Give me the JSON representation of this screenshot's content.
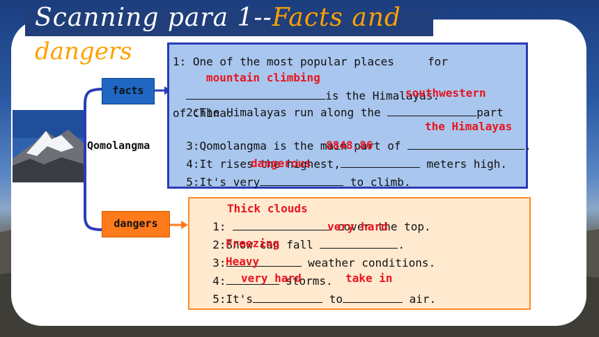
{
  "title": {
    "part1": "Scanning para 1--",
    "part2": "Facts and",
    "part3": "dangers"
  },
  "center_label": "Qomolangma",
  "tags": {
    "facts": "facts",
    "dangers": "dangers"
  },
  "facts": {
    "l1a": "1: One of the most popular places     for",
    "l2b": "is the Himalayas.",
    "l3": "2:The Himalayas run along the",
    "l3b": "part",
    "l4": "of China.",
    "l5": "3:Qomolangma is the main part of",
    "l5b": ".",
    "l6": "4:It rises the highest,",
    "l6b": "meters high.",
    "l7": "5:It's very",
    "l7b": "to climb.",
    "answers": [
      "mountain climbing",
      "southwestern",
      "the Himalayas",
      "8848.86",
      "dangerous"
    ]
  },
  "dangers": {
    "l1": "1:",
    "l1b": "cover the top.",
    "l2": "2:Snow can fall",
    "l2b": ".",
    "l3": "3:",
    "l3b": "weather conditions.",
    "l4": "4:",
    "l4b": "storms.",
    "l5": "5:It's",
    "l5m": "to",
    "l5b": "air.",
    "answers": [
      "Thick clouds",
      "very hard",
      "Freezing",
      "Heavy",
      "very hard",
      "take in"
    ]
  },
  "colors": {
    "title_bar": "#1f3e7a",
    "accent_orange": "#ffa000",
    "answer_red": "#e8141e",
    "facts_box": "#a9c6ee",
    "dangers_box": "#ffe9cf"
  }
}
